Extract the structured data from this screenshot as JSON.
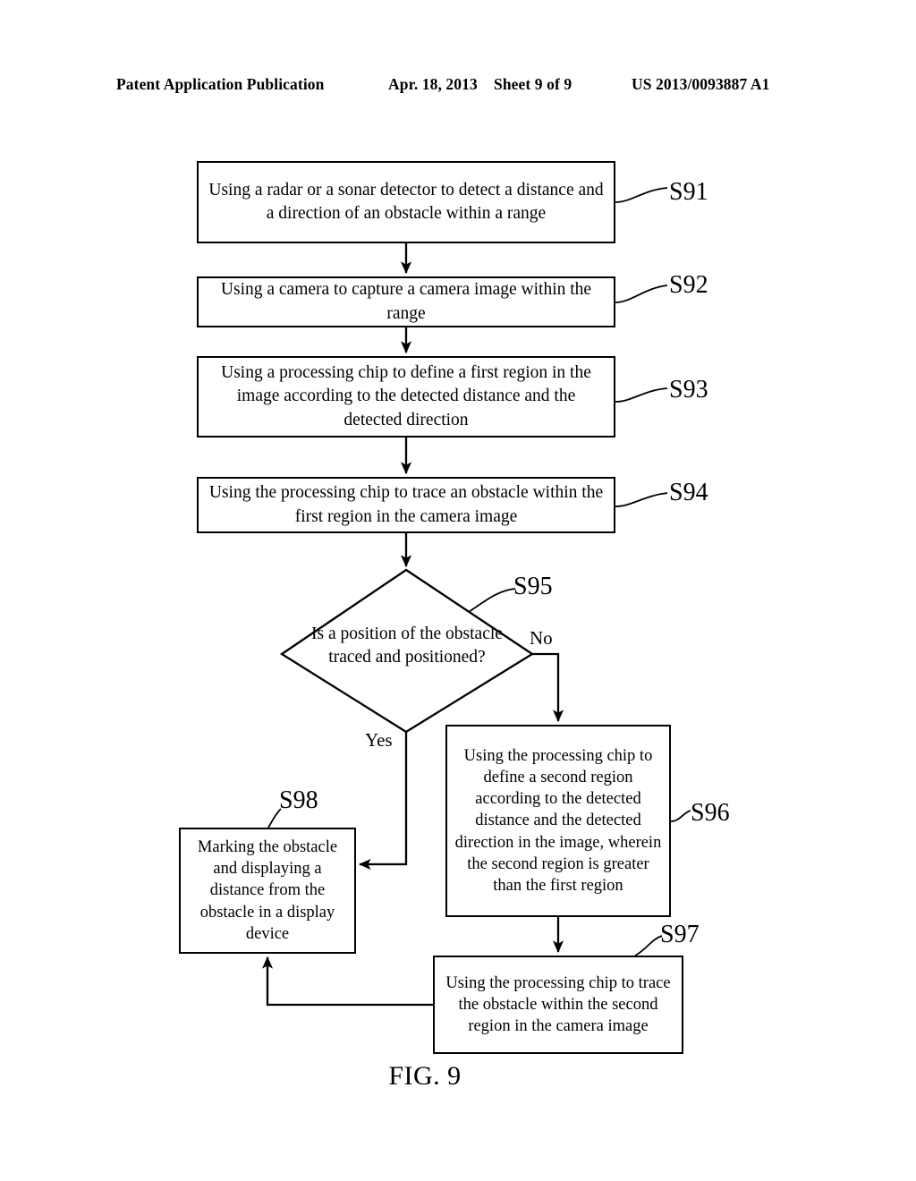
{
  "header": {
    "publication": "Patent Application Publication",
    "date": "Apr. 18, 2013",
    "sheet": "Sheet 9 of 9",
    "patent_number": "US 2013/0093887 A1"
  },
  "figure": {
    "caption": "FIG. 9"
  },
  "flowchart": {
    "nodes": [
      {
        "id": "S91",
        "ref": "S91",
        "type": "process",
        "text": "Using a radar or a sonar detector to detect a distance and a direction of an obstacle within a range"
      },
      {
        "id": "S92",
        "ref": "S92",
        "type": "process",
        "text": "Using a camera to capture a camera image within the range"
      },
      {
        "id": "S93",
        "ref": "S93",
        "type": "process",
        "text": "Using a processing chip to define a first region in the image according to the detected distance and the detected direction"
      },
      {
        "id": "S94",
        "ref": "S94",
        "type": "process",
        "text": "Using the processing chip to trace an obstacle within the first region in the camera image"
      },
      {
        "id": "S95",
        "ref": "S95",
        "type": "decision",
        "text": "Is a position of the obstacle traced and positioned?"
      },
      {
        "id": "S96",
        "ref": "S96",
        "type": "process",
        "text": "Using the processing chip to define a second region according to the detected distance and the detected direction in the image, wherein the second region is greater than the first region"
      },
      {
        "id": "S97",
        "ref": "S97",
        "type": "process",
        "text": "Using the processing chip to trace the obstacle within the second region in the camera image"
      },
      {
        "id": "S98",
        "ref": "S98",
        "type": "process",
        "text": "Marking the obstacle and displaying a distance from the obstacle in a display device"
      }
    ],
    "branches": {
      "no_label": "No",
      "yes_label": "Yes"
    },
    "edges": [
      {
        "from": "S91",
        "to": "S92",
        "label": ""
      },
      {
        "from": "S92",
        "to": "S93",
        "label": ""
      },
      {
        "from": "S93",
        "to": "S94",
        "label": ""
      },
      {
        "from": "S94",
        "to": "S95",
        "label": ""
      },
      {
        "from": "S95",
        "to": "S96",
        "label": "No"
      },
      {
        "from": "S95",
        "to": "S98",
        "label": "Yes"
      },
      {
        "from": "S96",
        "to": "S97",
        "label": ""
      },
      {
        "from": "S97",
        "to": "S98",
        "label": ""
      }
    ],
    "style": {
      "line_color": "#000000",
      "fill_color": "#ffffff"
    }
  }
}
